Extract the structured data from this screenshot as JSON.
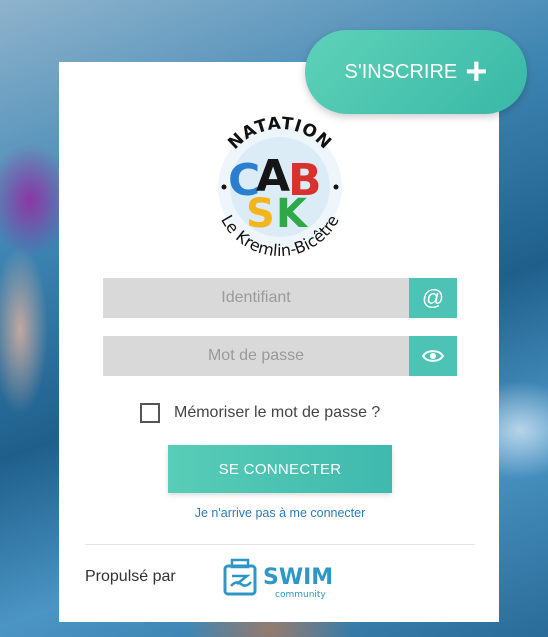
{
  "signup": {
    "label": "S'INSCRIRE",
    "icon": "plus-icon"
  },
  "logo": {
    "arc_top": "NATATION",
    "letters_top": [
      "C",
      "A",
      "B"
    ],
    "letters_bottom": [
      "S",
      "K"
    ],
    "arc_bottom": "Le Kremlin-Bicêtre"
  },
  "login": {
    "username_placeholder": "Identifiant",
    "username_icon": "at-sign-icon",
    "password_placeholder": "Mot de passe",
    "password_icon": "eye-icon",
    "remember_label": "Mémoriser le mot de passe ?",
    "submit_label": "SE CONNECTER",
    "forgot_link": "Je n'arrive pas à me connecter"
  },
  "footer": {
    "powered_by": "Propulsé par",
    "brand_name": "SWIM",
    "brand_sub": "community"
  },
  "colors": {
    "accent": "#4cc3b4",
    "link": "#2b7bb9",
    "field_bg": "#d9d9d9"
  }
}
